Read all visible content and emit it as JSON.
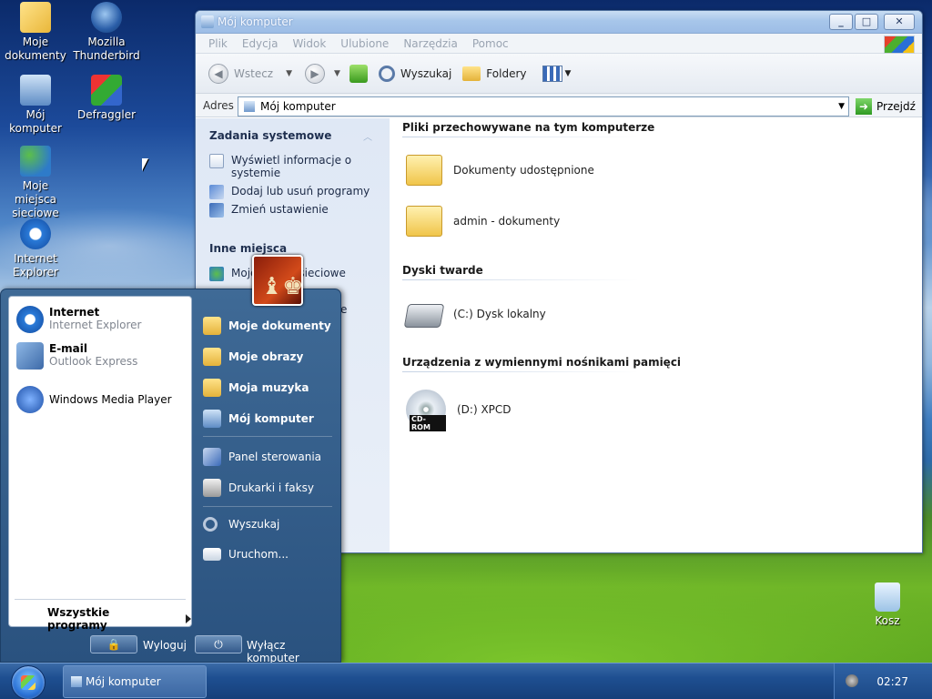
{
  "desktop": {
    "icons": [
      {
        "label_1": "Moje",
        "label_2": "dokumenty"
      },
      {
        "label_1": "Mozilla",
        "label_2": "Thunderbird"
      },
      {
        "label_1": "Mój komputer"
      },
      {
        "label_1": "Defraggler"
      },
      {
        "label_1": "Moje miejsca",
        "label_2": "sieciowe"
      },
      {
        "label_1": "Internet",
        "label_2": "Explorer"
      },
      {
        "label_1": "Kosz"
      }
    ]
  },
  "window": {
    "title": "Mój komputer",
    "menu": [
      "Plik",
      "Edycja",
      "Widok",
      "Ulubione",
      "Narzędzia",
      "Pomoc"
    ],
    "toolbar": {
      "back": "Wstecz",
      "search": "Wyszukaj",
      "folders": "Foldery"
    },
    "address": {
      "label": "Adres",
      "value": "Mój komputer",
      "go": "Przejdź"
    },
    "left_panel": {
      "system_tasks": {
        "title": "Zadania systemowe",
        "items": [
          "Wyświetl informacje o systemie",
          "Dodaj lub usuń programy",
          "Zmień ustawienie"
        ]
      },
      "other_places": {
        "title": "Inne miejsca",
        "visible_fragments": [
          "Moje",
          "sieciowe",
          "one"
        ]
      }
    },
    "groups": [
      {
        "title": "Pliki przechowywane na tym komputerze",
        "items": [
          "Dokumenty udostępnione",
          "admin - dokumenty"
        ]
      },
      {
        "title": "Dyski twarde",
        "items": [
          "(C:) Dysk lokalny"
        ]
      },
      {
        "title": "Urządzenia z wymiennymi nośnikami pamięci",
        "items": [
          "(D:) XPCD"
        ],
        "badge": "CD-ROM"
      }
    ]
  },
  "start_menu": {
    "pinned": [
      {
        "name": "Internet",
        "sub": "Internet Explorer"
      },
      {
        "name": "E-mail",
        "sub": "Outlook Express"
      },
      {
        "name": "Windows Media Player"
      }
    ],
    "all_programs": "Wszystkie programy",
    "right": [
      "Moje dokumenty",
      "Moje obrazy",
      "Moja muzyka",
      "Mój komputer",
      "Panel sterowania",
      "Drukarki i faksy",
      "Wyszukaj",
      "Uruchom..."
    ],
    "logoff": "Wyloguj",
    "shutdown": "Wyłącz komputer"
  },
  "taskbar": {
    "task": "Mój komputer",
    "clock": "02:27"
  },
  "colors": {
    "accent": "#2a527f",
    "window_title": "#a7c6ea"
  }
}
